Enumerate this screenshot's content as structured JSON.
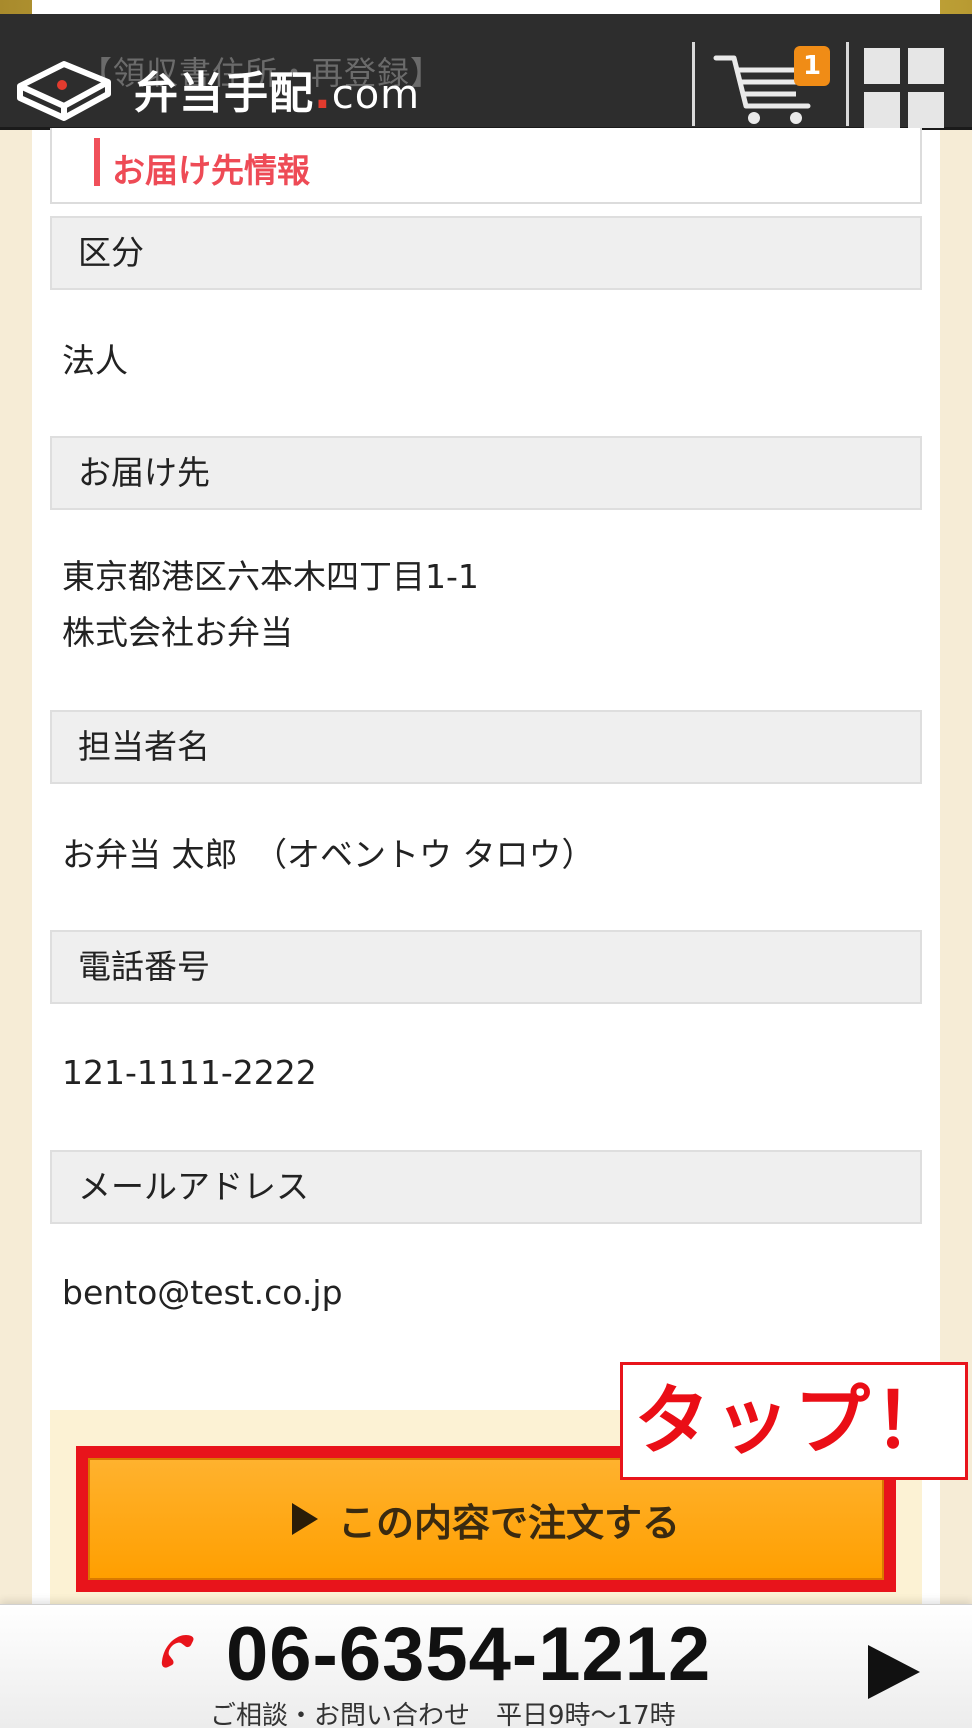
{
  "header": {
    "breadcrumb_behind": "【領収書住所・再登録】",
    "logo_text": "弁当手配",
    "logo_dot": ".",
    "logo_com": "com",
    "cart_count": "1"
  },
  "section": {
    "title": "お届け先情報"
  },
  "fields": [
    {
      "label": "区分",
      "value_lines": [
        "法人"
      ]
    },
    {
      "label": "お届け先",
      "value_lines": [
        "東京都港区六本木四丁目1-1",
        "株式会社お弁当"
      ]
    },
    {
      "label": "担当者名",
      "value_lines": [
        "お弁当 太郎　（オベントウ タロウ）"
      ]
    },
    {
      "label": "電話番号",
      "value_lines": [
        "121-1111-2222"
      ]
    },
    {
      "label": "メールアドレス",
      "value_lines": [
        "bento@test.co.jp"
      ]
    }
  ],
  "order": {
    "button_label": "この内容で注文する",
    "tap_callout": "タップ！"
  },
  "footer": {
    "phone": "06-6354-1212",
    "caption": "ご相談・お問い合わせ　平日9時〜17時"
  },
  "colors": {
    "accent_red": "#ee4b56",
    "order_orange": "#ff9f00",
    "callout_red": "#ea0e16",
    "header_dark": "#2d2d2d"
  },
  "icons": [
    "bento-box-logo-icon",
    "cart-icon",
    "grid-menu-icon",
    "play-triangle-icon",
    "phone-icon",
    "arrow-right-icon"
  ]
}
